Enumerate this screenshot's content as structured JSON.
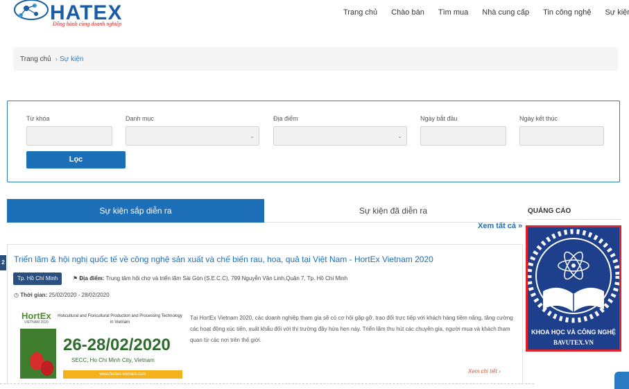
{
  "header": {
    "logo_text": "HATEX",
    "slogan": "Đồng hành cùng doanh nghiệp",
    "nav": [
      "Trang chủ",
      "Chào bán",
      "Tìm mua",
      "Nhà cung cấp",
      "Tin công nghệ",
      "Sự kiện"
    ]
  },
  "breadcrumb": {
    "home": "Trang chủ",
    "separator": "›",
    "current": "Sự kiện"
  },
  "filter": {
    "keyword_label": "Từ khóa",
    "category_label": "Danh mục",
    "location_label": "Địa điểm",
    "start_label": "Ngày bắt đầu",
    "end_label": "Ngày kết thúc",
    "keyword_value": "",
    "category_value": "",
    "location_value": "",
    "start_value": "",
    "end_value": "",
    "submit_label": "Lọc"
  },
  "tabs": {
    "upcoming": "Sự kiện sắp diễn ra",
    "past": "Sự kiện đã diễn ra"
  },
  "see_all": "Xem tất cả »",
  "event": {
    "title": "Triển lãm & hội nghị quốc tế về công nghệ sản xuất và chế biến rau, hoa, quả tại Việt Nam - HortEx Vietnam 2020",
    "city": "Tp. Hồ Chí Minh",
    "place_label": "Địa điểm:",
    "place": "Trung tâm hội chợ và triển lãm Sài Gòn (S.E.C.C), 799 Nguyễn Văn Linh,Quận 7, Tp. Hồ Chí Minh",
    "time_label": "Thời gian:",
    "time": "25/02/2020 - 28/02/2020",
    "description": "Tại HortEx Vietnam 2020, các doanh nghiệp tham gia sẽ có cơ hội gặp gỡ, trao đổi trực tiếp với khách hàng tiềm năng, tăng cường các hoạt động xúc tiến, xuất khẩu đối với thị trường đầy hứa hẹn này. Triển lãm thu hút các chuyên gia, người mua và khách tham quan từ các nơi trên thế giới.",
    "detail_link": "Xem chi tiết ›",
    "image": {
      "logo": "HortEx",
      "logo_sub": "VIETNAM 2020",
      "subtitle": "Hoticultural and Floricultural Production and Processing Technology in Vietnam",
      "date": "26-28/02/2020",
      "venue": "SECC, Ho Chi Minh City, Vietnam",
      "url": "www.hortex-vietnam.com"
    }
  },
  "ad": {
    "heading": "QUẢNG CÁO",
    "line1": "KHOA HỌC VÀ CÔNG NGHỆ",
    "line2": "BAVUTEX.VN"
  },
  "side_number": "2",
  "colors": {
    "primary": "#1d6fb8",
    "accent": "#e2222b",
    "badge": "#2b4f7e"
  }
}
